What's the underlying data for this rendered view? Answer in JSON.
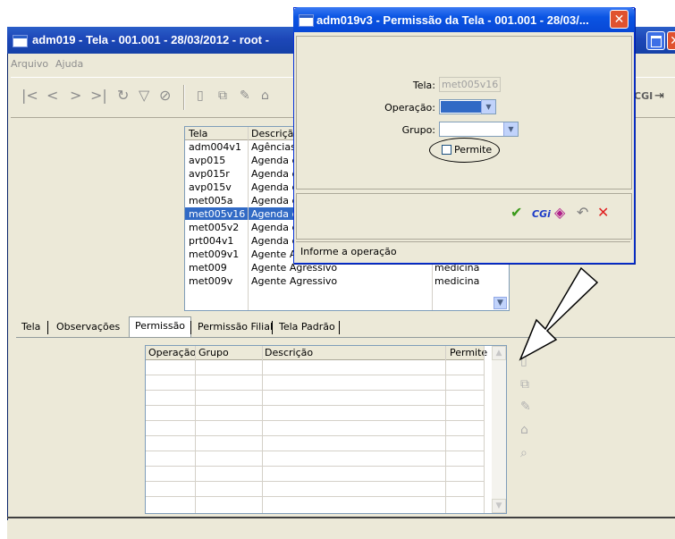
{
  "main_window": {
    "title": "adm019 - Tela - 001.001 - 28/03/2012 - root -"
  },
  "menu": [
    "Arquivo",
    "Ajuda"
  ],
  "toolbar": {
    "nav_icons": [
      "first-icon",
      "prev-icon",
      "next-icon",
      "last-icon",
      "refresh-icon",
      "filter-icon",
      "clear-filter-icon"
    ],
    "edit_icons": [
      "new-icon",
      "copy-icon",
      "edit-icon",
      "delete-icon"
    ],
    "right_label": "CGI"
  },
  "screens_grid": {
    "columns": [
      "Tela",
      "Descriçã"
    ],
    "rows": [
      {
        "tela": "adm004v1",
        "descricao": "Agências",
        "grupo": ""
      },
      {
        "tela": "avp015",
        "descricao": "Agenda d",
        "grupo": ""
      },
      {
        "tela": "avp015r",
        "descricao": "Agenda d",
        "grupo": ""
      },
      {
        "tela": "avp015v",
        "descricao": "Agenda d",
        "grupo": ""
      },
      {
        "tela": "met005a",
        "descricao": "Agenda d",
        "grupo": ""
      },
      {
        "tela": "met005v16",
        "descricao": "Agenda d",
        "grupo": "",
        "selected": true
      },
      {
        "tela": "met005v2",
        "descricao": "Agenda d",
        "grupo": ""
      },
      {
        "tela": "prt004v1",
        "descricao": "Agenda d",
        "grupo": ""
      },
      {
        "tela": "met009v1",
        "descricao": "Agente Agressivo",
        "grupo": "medicina"
      },
      {
        "tela": "met009",
        "descricao": "Agente Agressivo",
        "grupo": "medicina"
      },
      {
        "tela": "met009v",
        "descricao": "Agente Agressivo",
        "grupo": "medicina"
      }
    ]
  },
  "tabs": [
    "Tela",
    "Observações",
    "Permissão",
    "Permissão Filial",
    "Tela Padrão"
  ],
  "active_tab": "Permissão",
  "permission_grid": {
    "columns": [
      "Operação",
      "Grupo",
      "Descrição",
      "Permite"
    ]
  },
  "side_icons": [
    "new-icon",
    "copy-icon",
    "edit-icon",
    "delete-icon",
    "search-icon"
  ],
  "dialog": {
    "title": "adm019v3 - Permissão da Tela - 001.001 - 28/03/...",
    "tela_label": "Tela:",
    "tela_value": "met005v16",
    "operacao_label": "Operação:",
    "grupo_label": "Grupo:",
    "permite_label": "Permite",
    "cgi_label": "CGi",
    "status": "Informe a operação"
  },
  "colors": {
    "title_blue": "#0a54e3",
    "selection": "#316ac5",
    "confirm_green": "#3a9a1a",
    "cancel_red": "#e02020",
    "cgi_blue": "#1d3cc8"
  }
}
